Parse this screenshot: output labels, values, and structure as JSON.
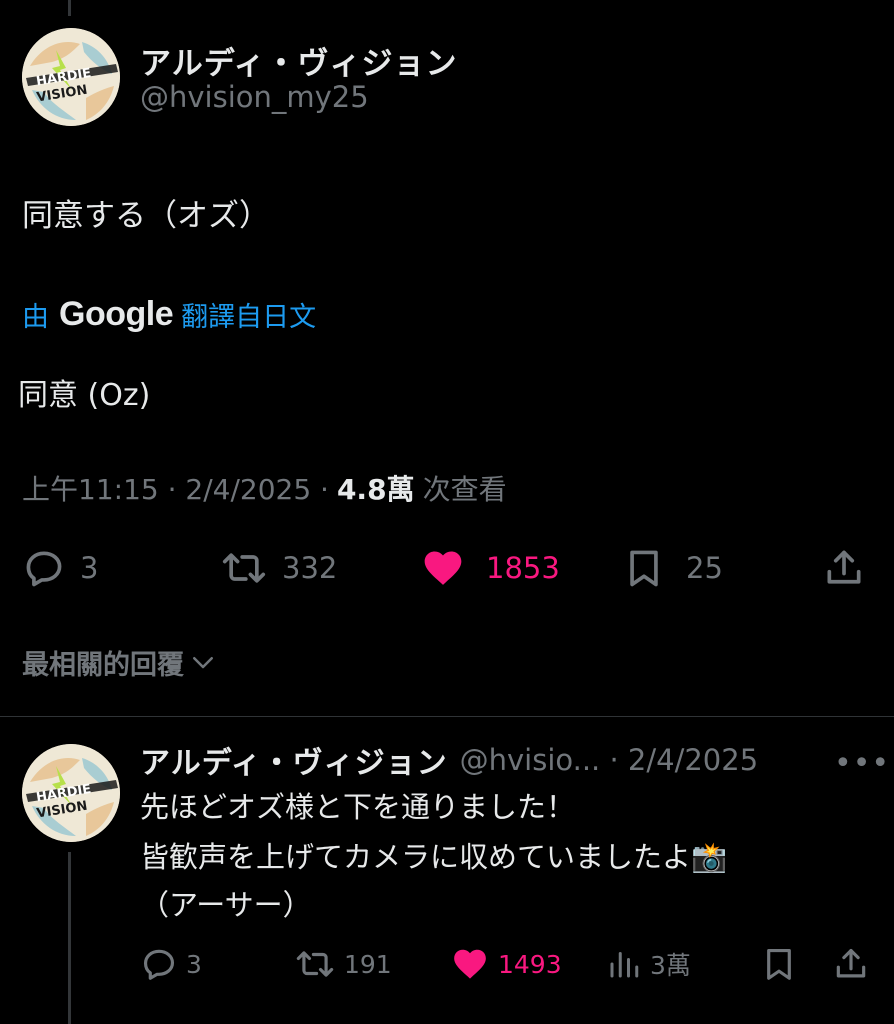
{
  "main_post": {
    "display_name": "アルディ・ヴィジョン",
    "handle": "@hvision_my25",
    "avatar_text": "HARDIE VISION",
    "text": "同意する（オズ）",
    "translation": {
      "prefix": "由",
      "provider": "Google",
      "suffix": "翻譯自日文",
      "text": "同意 (Oz)"
    },
    "meta": {
      "timestamp": "上午11:15 · 2/4/2025 ·",
      "views_count": "4.8萬",
      "views_label": "次查看"
    },
    "actions": {
      "replies": "3",
      "reposts": "332",
      "likes": "1853",
      "bookmarks": "25"
    }
  },
  "replies_sort": {
    "label": "最相關的回覆"
  },
  "reply": {
    "display_name": "アルディ・ヴィジョン",
    "handle_date": "@hvisio... · 2/4/2025",
    "more": "•••",
    "line1": "先ほどオズ様と下を通りました！",
    "line2": "皆歓声を上げてカメラに収めていましたよ📸",
    "line3": "（アーサー）",
    "actions": {
      "replies": "3",
      "reposts": "191",
      "likes": "1493",
      "views": "3萬"
    }
  },
  "colors": {
    "background": "#000000",
    "text_primary": "#e7e9ea",
    "text_secondary": "#71767b",
    "link_blue": "#1d9bf0",
    "like_pink": "#f91880",
    "divider": "#2f3336"
  },
  "icons": {
    "reply": "reply-icon",
    "repost": "repost-icon",
    "like": "heart-icon",
    "bookmark": "bookmark-icon",
    "share": "share-icon",
    "views": "views-chart-icon",
    "sort": "chevron-down-icon",
    "more": "more-options-icon",
    "camera": "camera-flash-emoji"
  }
}
